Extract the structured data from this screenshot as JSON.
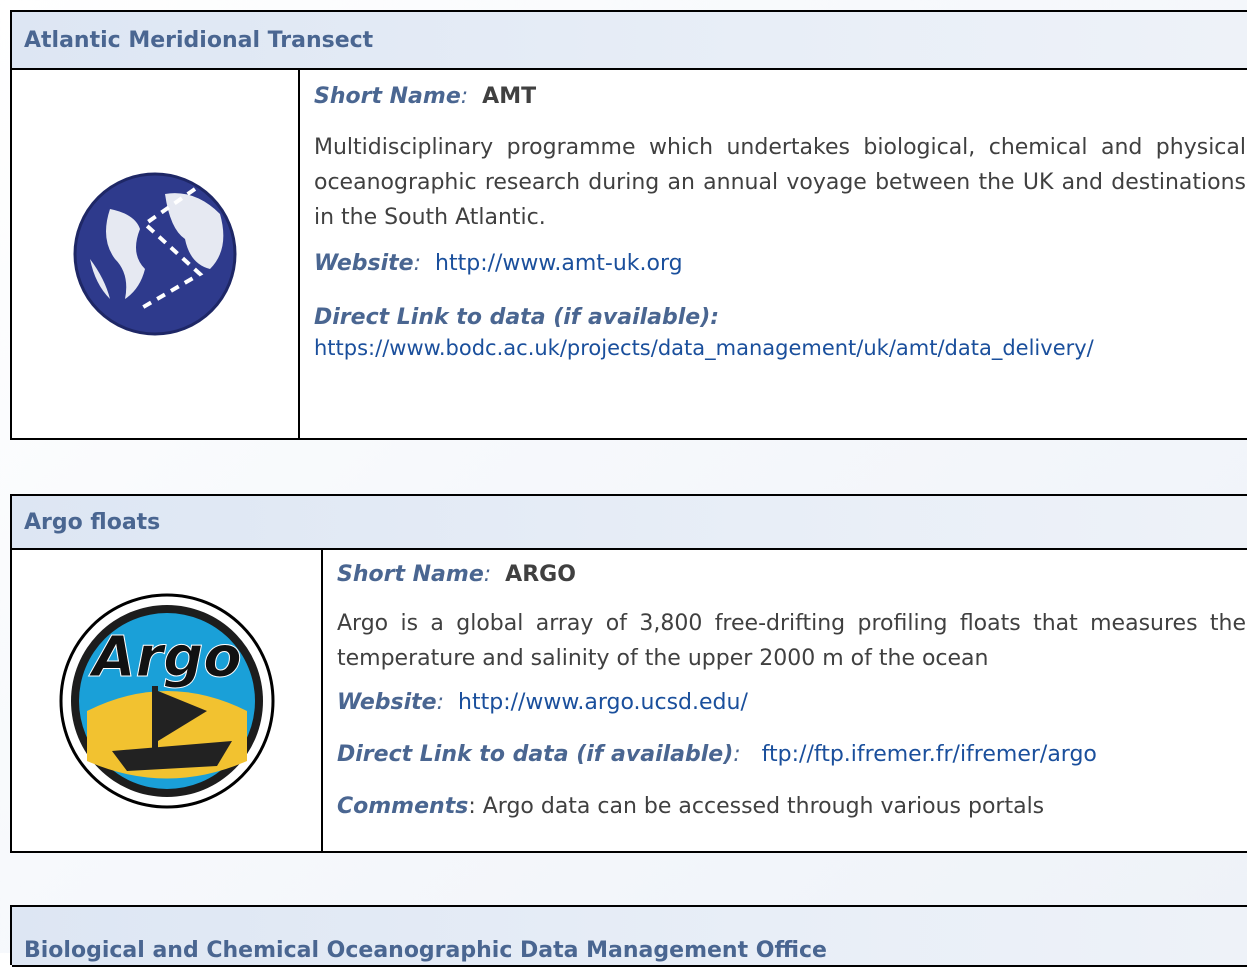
{
  "entries": [
    {
      "title": "Atlantic Meridional Transect",
      "short_name_label": "Short Name",
      "short_name": "AMT",
      "description": "Multidisciplinary programme which undertakes biological, chemical and physical oceanographic research during an annual voyage between the UK and destinations in the South Atlantic.",
      "website_label": "Website",
      "website": "http://www.amt-uk.org",
      "direct_link_label": "Direct Link to data (if available):",
      "direct_link": "https://www.bodc.ac.uk/projects/data_management/uk/amt/data_delivery/",
      "logo": "globe-transect-icon"
    },
    {
      "title": "Argo floats",
      "short_name_label": "Short Name",
      "short_name": "ARGO",
      "description": "Argo is a global array of 3,800 free-drifting profiling floats that measures the temperature and salinity of the upper 2000 m of the ocean",
      "website_label": "Website",
      "website": "http://www.argo.ucsd.edu/",
      "direct_link_label": "Direct Link to data (if available)",
      "direct_link": "ftp://ftp.ifremer.fr/ifremer/argo",
      "comments_label": "Comments",
      "comments": "Argo data can be accessed through various portals",
      "logo": "argo-logo",
      "logo_text": "Argo"
    },
    {
      "title": "Biological and Chemical Oceanographic Data Management Office"
    }
  ],
  "colors": {
    "header_text": "#4a6691",
    "link": "#1a4f9c",
    "header_bg": "#dde6f3",
    "globe": "#2e3a8c"
  }
}
